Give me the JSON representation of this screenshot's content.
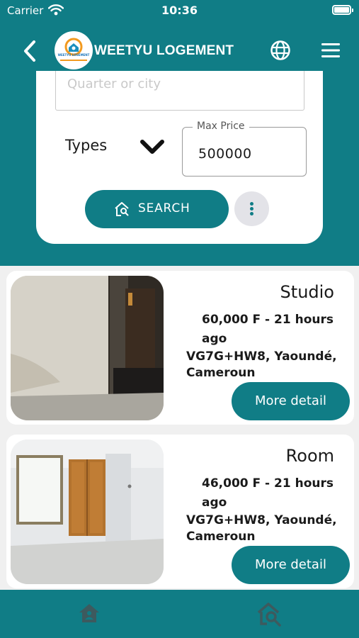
{
  "status_bar": {
    "carrier": "Carrier",
    "time": "10:36"
  },
  "header": {
    "title": "WEETYU LOGEMENT",
    "logo_text": "WEETYU LOGEMENT"
  },
  "search": {
    "location_placeholder": "Quarter or city",
    "types_label": "Types",
    "max_price_label": "Max Price",
    "max_price_value": "500000",
    "search_label": "SEARCH"
  },
  "listings": [
    {
      "title": "Studio",
      "price_time": "60,000 F - 21 hours ago",
      "location": "VG7G+HW8, Yaoundé, Cameroun",
      "button": "More detail"
    },
    {
      "title": "Room",
      "price_time": "46,000 F - 21 hours ago",
      "location": "VG7G+HW8, Yaoundé, Cameroun",
      "button": "More detail"
    }
  ],
  "colors": {
    "primary": "#107d86",
    "background": "#f0f0f0"
  },
  "icons": {
    "back": "chevron-left-icon",
    "language": "globe-icon",
    "menu": "hamburger-menu-icon",
    "types": "chevron-down-icon",
    "search": "home-search-icon",
    "more": "more-vertical-icon",
    "nav_home": "home-icon",
    "nav_search": "home-search-icon"
  }
}
